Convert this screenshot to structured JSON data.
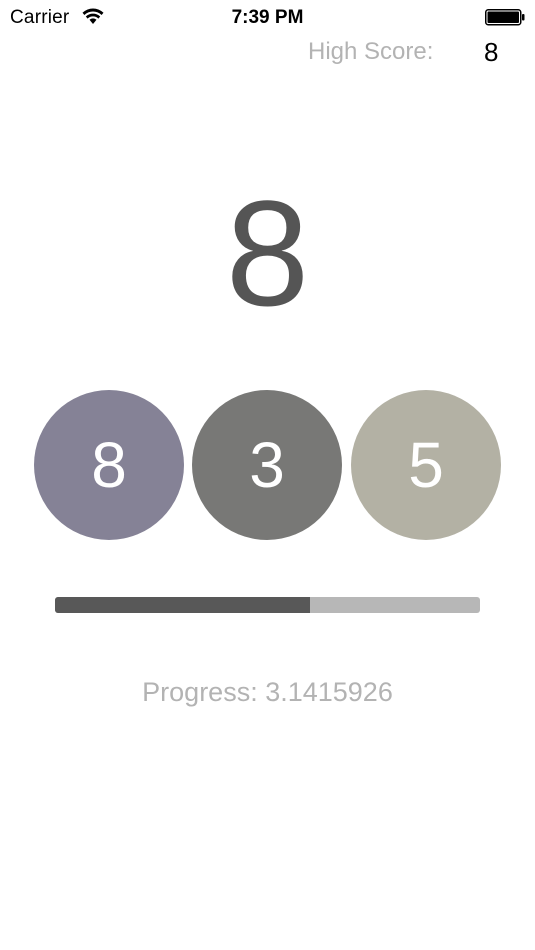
{
  "status_bar": {
    "carrier": "Carrier",
    "time": "7:39 PM",
    "icons": [
      "wifi-icon",
      "battery-icon"
    ]
  },
  "high_score": {
    "label": "High Score:",
    "value": "8"
  },
  "current_number": "8",
  "circles": [
    {
      "value": "8",
      "color": "#858296"
    },
    {
      "value": "3",
      "color": "#787876"
    },
    {
      "value": "5",
      "color": "#b3b1a4"
    }
  ],
  "progress": {
    "fraction": 0.6,
    "fill_color": "#585858",
    "track_color": "#b7b7b7",
    "text": "Progress: 3.1415926"
  }
}
